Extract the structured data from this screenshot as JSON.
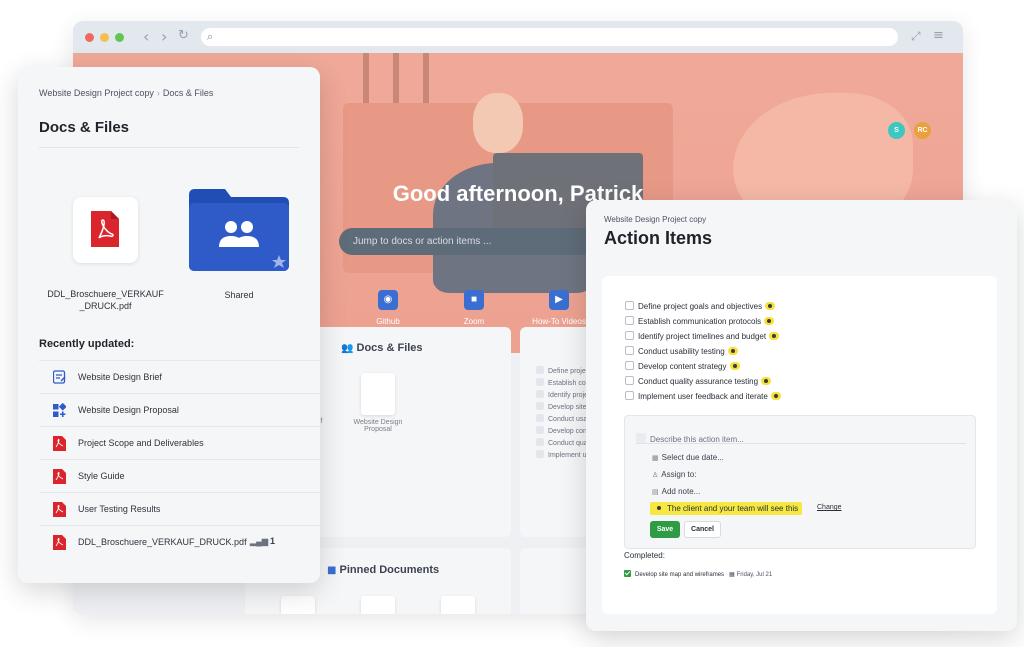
{
  "browser": {
    "greeting": "Good afternoon, Patrick",
    "search_placeholder": "Jump to docs or action items ...",
    "avatars": [
      "S",
      "RC"
    ],
    "quick_links": [
      "Github",
      "Zoom",
      "How-To Videos"
    ],
    "docs_widget": {
      "title": "Docs & Files",
      "partial_label": "ief",
      "doc_label_line1": "Website Design",
      "doc_label_line2": "Proposal"
    },
    "action_widget_items": [
      "Define projec",
      "Establish com",
      "Identify proje",
      "Develop site",
      "Conduct usa",
      "Develop cont",
      "Conduct qua",
      "Implement us"
    ],
    "pinned_widget": {
      "title": "Pinned Documents"
    }
  },
  "docs_panel": {
    "breadcrumb_parent": "Website Design Project copy",
    "breadcrumb_current": "Docs & Files",
    "title": "Docs & Files",
    "grid": [
      {
        "label_line1": "DDL_Broschuere_VERKAUF",
        "label_line2": "_DRUCK.pdf",
        "icon": "pdf-icon"
      },
      {
        "label_line1": "Shared",
        "icon": "shared-folder-icon"
      }
    ],
    "recent_title": "Recently updated:",
    "recent": [
      {
        "label": "Website Design Brief",
        "icon": "document-edit-icon"
      },
      {
        "label": "Website Design Proposal",
        "icon": "apps-grid-icon"
      },
      {
        "label": "Project Scope and Deliverables",
        "icon": "pdf-icon"
      },
      {
        "label": "Style Guide",
        "icon": "pdf-icon"
      },
      {
        "label": "User Testing Results",
        "icon": "pdf-icon"
      },
      {
        "label": "DDL_Broschuere_VERKAUF_DRUCK.pdf",
        "icon": "pdf-icon",
        "versions": "1"
      }
    ]
  },
  "action_panel": {
    "project": "Website Design Project copy",
    "title": "Action Items",
    "items": [
      "Define project goals and objectives",
      "Establish communication protocols",
      "Identify project timelines and budget",
      "Conduct usability testing",
      "Develop content strategy",
      "Conduct quality assurance testing",
      "Implement user feedback and iterate"
    ],
    "form": {
      "placeholder": "Describe this action item...",
      "due_date": "Select due date...",
      "assign": "Assign to:",
      "note": "Add note...",
      "visibility": "The client and your team will see this",
      "change": "Change",
      "save": "Save",
      "cancel": "Cancel"
    },
    "completed_title": "Completed:",
    "completed": [
      {
        "label": "Develop site map and wireframes",
        "date": "Friday, Jul 21"
      }
    ]
  },
  "colors": {
    "accent_blue": "#2f5bc9",
    "pdf_red": "#d9252b",
    "save_green": "#2f9c45",
    "highlight_yellow": "#f7e743"
  }
}
